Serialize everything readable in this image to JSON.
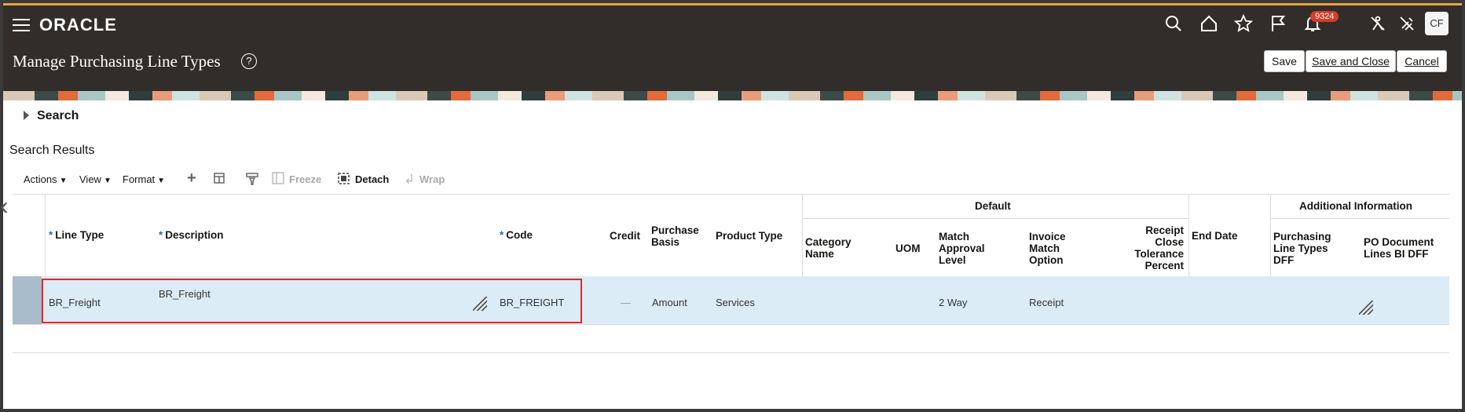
{
  "header": {
    "logo": "ORACLE",
    "notification_count": "9324",
    "avatar_initials": "CF",
    "icons": [
      "search-icon",
      "home-icon",
      "favorites-star-icon",
      "flag-icon",
      "notifications-bell-icon",
      "accessibility-icon",
      "settings-icon"
    ]
  },
  "page": {
    "title": "Manage Purchasing Line Types",
    "buttons": {
      "save": "Save",
      "save_and_close": "Save and Close",
      "cancel": "Cancel"
    }
  },
  "search": {
    "label": "Search",
    "results_title": "Search Results"
  },
  "toolbar": {
    "actions": "Actions",
    "view": "View",
    "format": "Format",
    "freeze": "Freeze",
    "detach": "Detach",
    "wrap": "Wrap"
  },
  "table": {
    "group_default": "Default",
    "group_additional": "Additional Information",
    "columns": {
      "line_type": "Line Type",
      "description": "Description",
      "code": "Code",
      "credit": "Credit",
      "purchase_basis": "Purchase Basis",
      "product_type": "Product Type",
      "category_name": "Category Name",
      "uom": "UOM",
      "match_approval_level": "Match Approval Level",
      "invoice_match_option": "Invoice Match Option",
      "receipt_close_tolerance": "Receipt Close Tolerance Percent",
      "end_date": "End Date",
      "purchasing_line_types_dff": "Purchasing Line Types DFF",
      "po_document_lines_bi_dff": "PO Document Lines BI DFF"
    },
    "rows": [
      {
        "line_type": "BR_Freight",
        "description": "BR_Freight",
        "code": "BR_FREIGHT",
        "credit": "—",
        "purchase_basis": "Amount",
        "product_type": "Services",
        "category_name": "",
        "uom": "",
        "match_approval_level": "2 Way",
        "invoice_match_option": "Receipt",
        "receipt_close_tolerance": "",
        "end_date": ""
      }
    ]
  }
}
